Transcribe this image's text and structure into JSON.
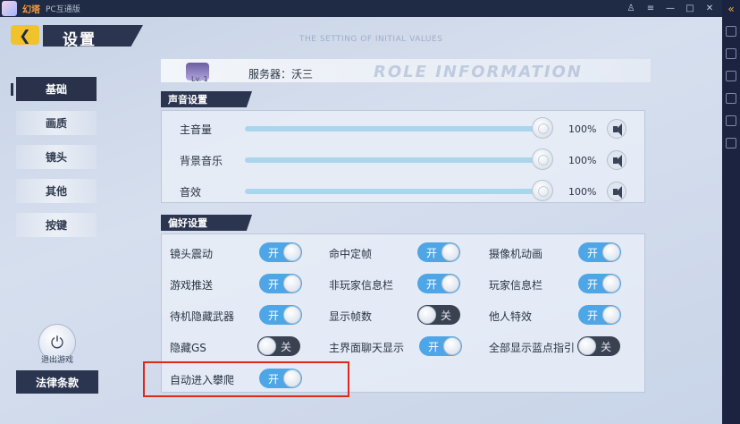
{
  "window": {
    "app_name": "幻塔",
    "app_subtitle": "PC互通版",
    "controls": [
      "♙",
      "≡",
      "—",
      "□",
      "✕"
    ]
  },
  "header": {
    "back_icon": "chevron-left-icon",
    "title": "设置",
    "watermark": "THE SETTING OF INITIAL VALUES"
  },
  "nav": {
    "items": [
      {
        "label": "基础",
        "active": true
      },
      {
        "label": "画质",
        "active": false
      },
      {
        "label": "镜头",
        "active": false
      },
      {
        "label": "其他",
        "active": false
      },
      {
        "label": "按键",
        "active": false
      }
    ],
    "exit_label": "退出游戏",
    "law_label": "法律条款"
  },
  "role": {
    "level": "Lv. 1",
    "server": "服务器：沃三",
    "bg_text": "ROLE INFORMATION"
  },
  "sound": {
    "title": "声音设置",
    "rows": [
      {
        "label": "主音量",
        "value": "100%"
      },
      {
        "label": "背景音乐",
        "value": "100%"
      },
      {
        "label": "音效",
        "value": "100%"
      }
    ]
  },
  "prefs": {
    "title": "偏好设置",
    "on_label": "开",
    "off_label": "关",
    "items": [
      {
        "label": "镜头震动",
        "state": "on"
      },
      {
        "label": "命中定帧",
        "state": "on"
      },
      {
        "label": "摄像机动画",
        "state": "on"
      },
      {
        "label": "游戏推送",
        "state": "on"
      },
      {
        "label": "非玩家信息栏",
        "state": "on"
      },
      {
        "label": "玩家信息栏",
        "state": "on"
      },
      {
        "label": "待机隐藏武器",
        "state": "on"
      },
      {
        "label": "显示帧数",
        "state": "off"
      },
      {
        "label": "他人特效",
        "state": "on"
      },
      {
        "label": "隐藏GS",
        "state": "off"
      },
      {
        "label": "主界面聊天显示",
        "state": "on"
      },
      {
        "label": "全部显示蓝点指引",
        "state": "off"
      },
      {
        "label": "自动进入攀爬",
        "state": "on"
      }
    ]
  },
  "colors": {
    "toggle_on": "#4fa6e6",
    "toggle_off": "#3a4252",
    "accent": "#f0c22c",
    "highlight": "#e0281c"
  }
}
